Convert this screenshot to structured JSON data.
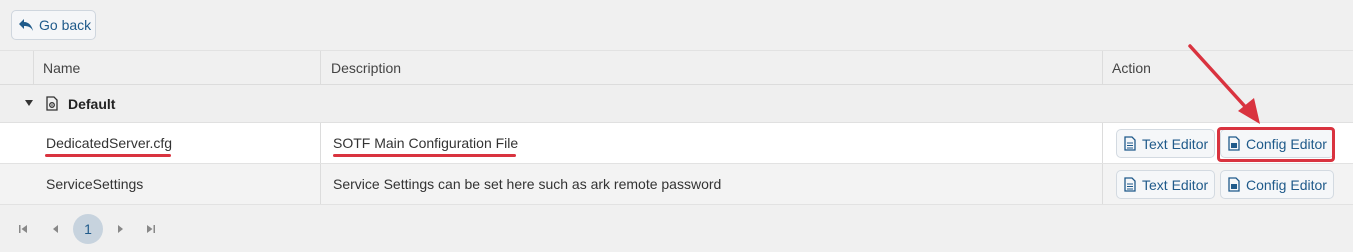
{
  "toolbar": {
    "go_back_label": "Go back"
  },
  "table": {
    "columns": {
      "name": "Name",
      "description": "Description",
      "action": "Action"
    },
    "group": {
      "label": "Default"
    },
    "rows": [
      {
        "name": "DedicatedServer.cfg",
        "description": "SOTF Main Configuration File",
        "text_editor": "Text Editor",
        "config_editor": "Config Editor"
      },
      {
        "name": "ServiceSettings",
        "description": "Service Settings can be set here such as ark remote password",
        "text_editor": "Text Editor",
        "config_editor": "Config Editor"
      }
    ]
  },
  "pagination": {
    "current_page": "1"
  },
  "annotation": {
    "color": "#d9333f"
  }
}
